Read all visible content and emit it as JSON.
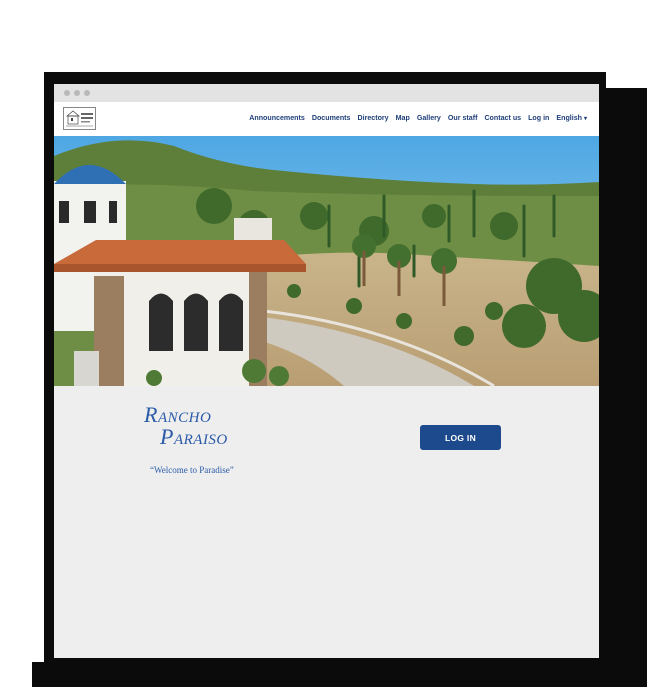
{
  "nav": {
    "items": [
      {
        "label": "Announcements"
      },
      {
        "label": "Documents"
      },
      {
        "label": "Directory"
      },
      {
        "label": "Map"
      },
      {
        "label": "Gallery"
      },
      {
        "label": "Our staff"
      },
      {
        "label": "Contact us"
      },
      {
        "label": "Log in"
      },
      {
        "label": "English"
      }
    ],
    "language_caret": "▾"
  },
  "brand": {
    "line1_cap": "R",
    "line1_rest": "ANCHO",
    "line2_cap": "P",
    "line2_rest": "ARAISO",
    "tagline": "“Welcome to Paradise”",
    "color": "#2a5aa8"
  },
  "main": {
    "login_button": "LOG IN"
  },
  "colors": {
    "nav_text": "#1f3f78",
    "button_bg": "#1d4a8c",
    "page_bg": "#eeeeee",
    "sky": "#5fb2e6"
  }
}
